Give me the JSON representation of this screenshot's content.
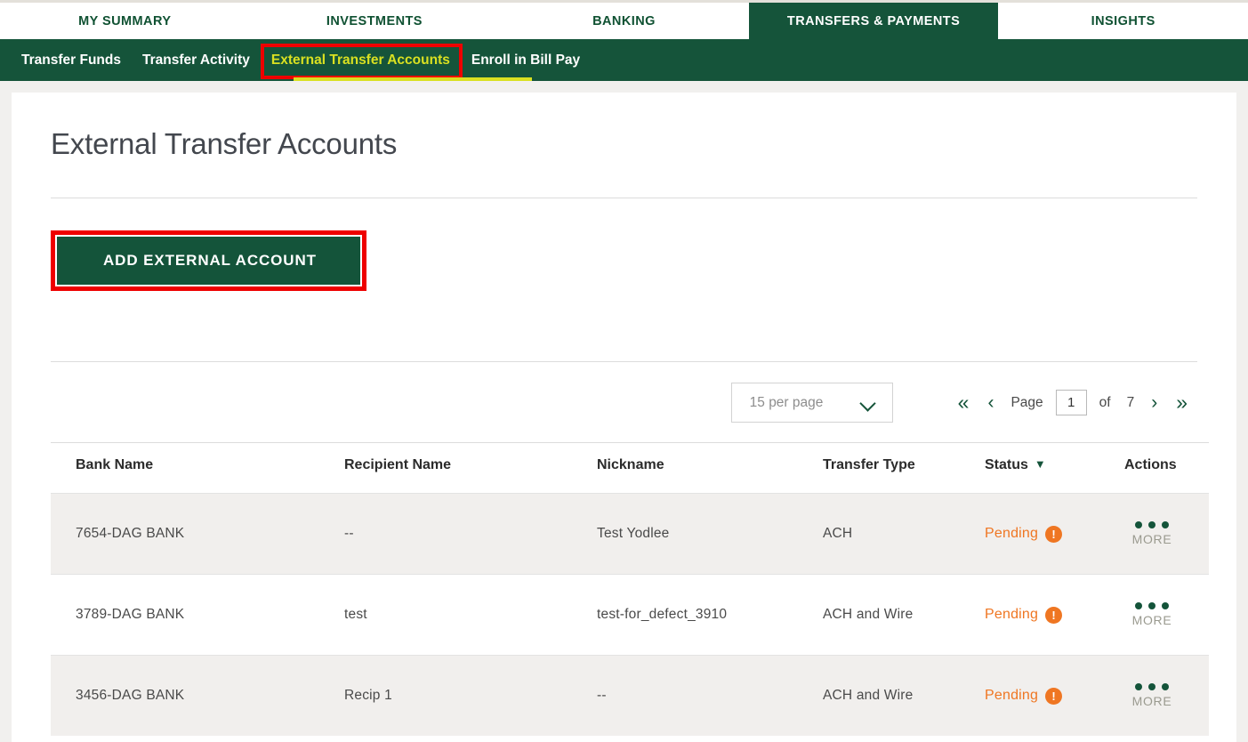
{
  "primary_nav": {
    "tabs": [
      {
        "label": "MY SUMMARY",
        "active": false
      },
      {
        "label": "INVESTMENTS",
        "active": false
      },
      {
        "label": "BANKING",
        "active": false
      },
      {
        "label": "TRANSFERS & PAYMENTS",
        "active": true
      },
      {
        "label": "INSIGHTS",
        "active": false
      }
    ]
  },
  "sub_nav": {
    "items": [
      {
        "label": "Transfer Funds",
        "current": false
      },
      {
        "label": "Transfer Activity",
        "current": false
      },
      {
        "label": "External Transfer Accounts",
        "current": true
      },
      {
        "label": "Enroll in Bill Pay",
        "current": false
      }
    ],
    "highlight_color": "#ee0000",
    "active_color": "#d9e021"
  },
  "page": {
    "title": "External Transfer Accounts"
  },
  "actions": {
    "add_external_account": "ADD EXTERNAL ACCOUNT"
  },
  "pagination": {
    "per_page_label": "15 per page",
    "first_icon": "«",
    "prev_icon": "‹",
    "page_label": "Page",
    "current_page": "1",
    "of_label": "of",
    "total_pages": "7",
    "next_icon": "›",
    "last_icon": "»"
  },
  "table": {
    "columns": [
      {
        "key": "bank_name",
        "label": "Bank Name",
        "sorted": false
      },
      {
        "key": "recipient_name",
        "label": "Recipient Name",
        "sorted": false
      },
      {
        "key": "nickname",
        "label": "Nickname",
        "sorted": false
      },
      {
        "key": "transfer_type",
        "label": "Transfer Type",
        "sorted": false
      },
      {
        "key": "status",
        "label": "Status",
        "sorted": true
      },
      {
        "key": "actions",
        "label": "Actions",
        "sorted": false
      }
    ],
    "sort_caret": "▼",
    "more_label": "MORE",
    "alert_glyph": "!",
    "rows": [
      {
        "bank_name": "7654-DAG BANK",
        "recipient_name": "--",
        "nickname": "Test Yodlee",
        "transfer_type": "ACH",
        "status": "Pending",
        "actions": "MORE",
        "shaded": true
      },
      {
        "bank_name": "3789-DAG BANK",
        "recipient_name": "test",
        "nickname": "test-for_defect_3910",
        "transfer_type": "ACH and Wire",
        "status": "Pending",
        "actions": "MORE",
        "shaded": false
      },
      {
        "bank_name": "3456-DAG BANK",
        "recipient_name": "Recip 1",
        "nickname": "--",
        "transfer_type": "ACH and Wire",
        "status": "Pending",
        "actions": "MORE",
        "shaded": true
      }
    ]
  },
  "colors": {
    "brand_green": "#15543a",
    "accent_yellow": "#d9e021",
    "annotation_red": "#ee0000",
    "status_orange": "#ef7622",
    "page_bg": "#f1f0ee",
    "row_shade": "#f1efed"
  }
}
